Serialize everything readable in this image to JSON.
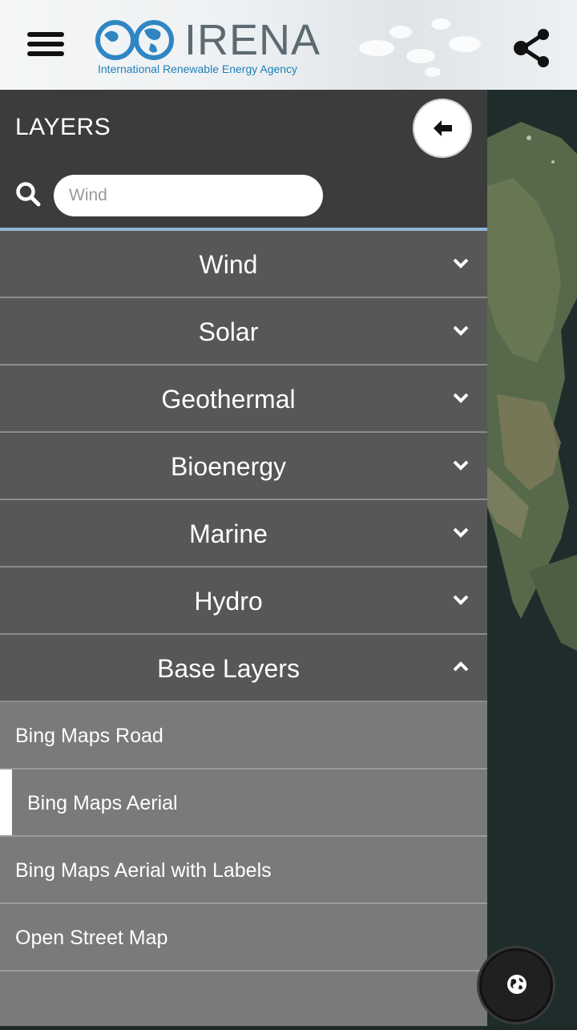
{
  "header": {
    "logo_word": "IRENA",
    "logo_subtitle": "International Renewable Energy Agency",
    "menu_icon": "hamburger-menu-icon",
    "share_icon": "share-icon"
  },
  "panel": {
    "title": "LAYERS",
    "back_icon": "arrow-left-icon",
    "search": {
      "placeholder": "Wind",
      "value": "",
      "icon": "search-icon"
    },
    "categories": [
      {
        "label": "Wind",
        "expanded": false
      },
      {
        "label": "Solar",
        "expanded": false
      },
      {
        "label": "Geothermal",
        "expanded": false
      },
      {
        "label": "Bioenergy",
        "expanded": false
      },
      {
        "label": "Marine",
        "expanded": false
      },
      {
        "label": "Hydro",
        "expanded": false
      },
      {
        "label": "Base Layers",
        "expanded": true
      }
    ],
    "base_layers": [
      {
        "label": "Bing Maps Road",
        "selected": false
      },
      {
        "label": "Bing Maps Aerial",
        "selected": true
      },
      {
        "label": "Bing Maps Aerial with Labels",
        "selected": false
      },
      {
        "label": "Open Street Map",
        "selected": false
      }
    ]
  },
  "map_controls": {
    "globe_icon": "globe-icon"
  },
  "colors": {
    "panel_header": "#3c3c3c",
    "category_bg": "#575757",
    "sublayer_bg": "#7a7a7a",
    "accent_separator": "#8fb6d4",
    "logo_blue": "#1f7fb8"
  }
}
